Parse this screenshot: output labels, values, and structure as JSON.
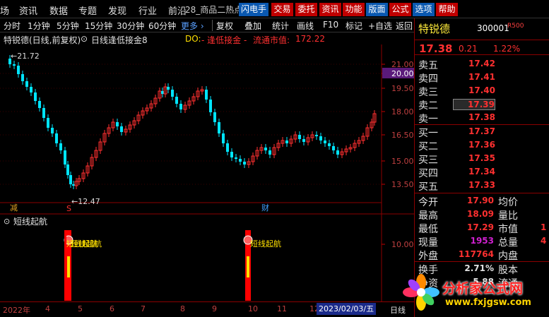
{
  "menu": {
    "items": [
      "场",
      "资讯",
      "数据",
      "专题",
      "发现",
      "行业",
      "前沿"
    ],
    "window_title": "28_商品二热点",
    "buttons": [
      {
        "label": "闪电手",
        "style": "blue"
      },
      {
        "label": "交易",
        "style": "red"
      },
      {
        "label": "委托",
        "style": "red"
      },
      {
        "label": "资讯",
        "style": "red"
      },
      {
        "label": "功能",
        "style": "red"
      },
      {
        "label": "版面",
        "style": "blue"
      },
      {
        "label": "公式",
        "style": "red"
      },
      {
        "label": "选项",
        "style": "blue"
      },
      {
        "label": "帮助",
        "style": "red"
      }
    ]
  },
  "toolbar": {
    "periods": [
      "分时",
      "1分钟",
      "5分钟",
      "15分钟",
      "30分钟",
      "60分钟"
    ],
    "more_label": "更多 ›",
    "actions": [
      "复权",
      "叠加",
      "统计",
      "画线",
      "F10",
      "标记",
      "+自选",
      "返回"
    ]
  },
  "info": {
    "stock_title": "特锐德(日线,前复权)",
    "indicator_name": "日线逢低接金8",
    "do_label": "DO:",
    "do_value": "- 逢低接金 -",
    "mcap_label": "流通市值:",
    "mcap_value": "172.22"
  },
  "chart": {
    "y_ticks": [
      "21.00",
      "20.00",
      "19.50",
      "18.00",
      "16.50",
      "15.00",
      "13.50"
    ],
    "high_label": "21.72",
    "low_label": "12.47",
    "marker_jian": "减",
    "marker_s": "S",
    "marker_cai": "财",
    "sub_title": "短线起航",
    "sub_y_tick": "10.00",
    "signal_label": "短线起航",
    "signal_label_overlap": "短线起航",
    "up_color": "#ff3030",
    "down_color": "#00e5ff",
    "signal_color": "#ff0000",
    "signal_yellow": "#ffe000"
  },
  "bottom": {
    "labels": [
      "2022年",
      "4",
      "5",
      "6",
      "7",
      "8",
      "9",
      "10",
      "11",
      "12"
    ],
    "date": "2023/02/03/五",
    "right_label": "日线"
  },
  "quote": {
    "name": "特锐德",
    "code": "300001",
    "tag": "R500",
    "price": "17.38",
    "change": "0.21",
    "change_pct": "1.22%",
    "asks": [
      {
        "label": "卖五",
        "price": "17.42"
      },
      {
        "label": "卖四",
        "price": "17.41"
      },
      {
        "label": "卖三",
        "price": "17.40"
      },
      {
        "label": "卖二",
        "price": "17.39"
      },
      {
        "label": "卖一",
        "price": "17.38"
      }
    ],
    "bids": [
      {
        "label": "买一",
        "price": "17.37"
      },
      {
        "label": "买二",
        "price": "17.36"
      },
      {
        "label": "买三",
        "price": "17.35"
      },
      {
        "label": "买四",
        "price": "17.34"
      },
      {
        "label": "买五",
        "price": "17.33"
      }
    ],
    "stats": [
      {
        "l1": "今开",
        "v1": "17.90",
        "c1": "#ff3030",
        "l2": "均价",
        "v2": ""
      },
      {
        "l1": "最高",
        "v1": "18.09",
        "c1": "#ff3030",
        "l2": "量比",
        "v2": ""
      },
      {
        "l1": "最低",
        "v1": "17.29",
        "c1": "#ff3030",
        "l2": "市值",
        "v2": "1"
      },
      {
        "l1": "现量",
        "v1": "1953",
        "c1": "#d020d0",
        "l2": "总量",
        "v2": "4"
      },
      {
        "l1": "外盘",
        "v1": "117764",
        "c1": "#ff3030",
        "l2": "内盘",
        "v2": ""
      },
      {
        "l1": "换手",
        "v1": "2.71%",
        "c1": "#e0e0e0",
        "l2": "股本",
        "v2": ""
      },
      {
        "l1": "净资",
        "v1": "5.88",
        "c1": "#e0e0e0",
        "l2": "流通",
        "v2": ""
      }
    ]
  },
  "logo": {
    "text": "分析家公式网",
    "url": "www.fxjgsw.com"
  }
}
